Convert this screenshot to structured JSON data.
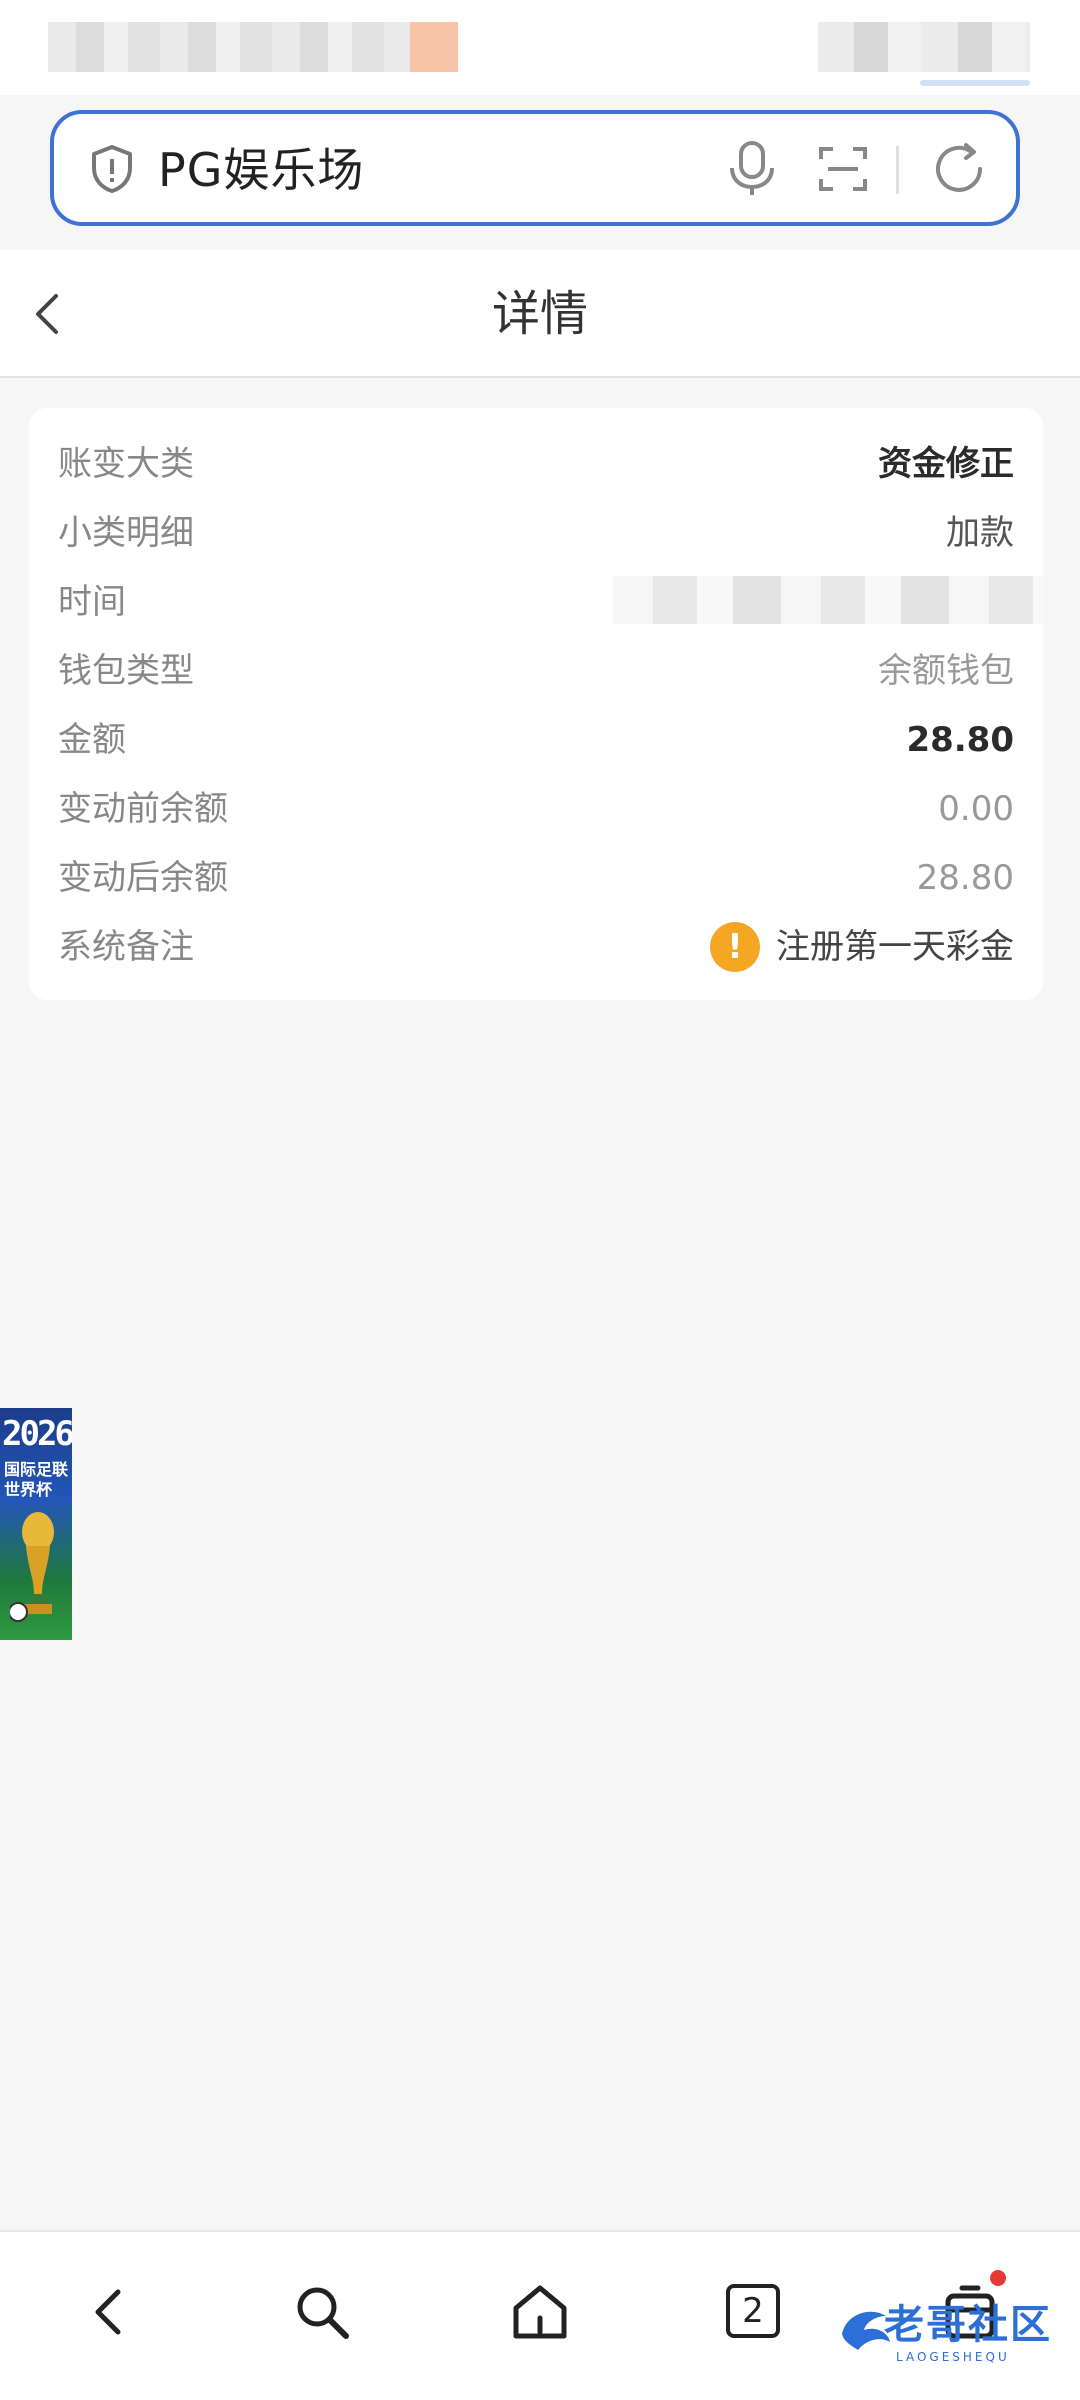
{
  "browser": {
    "url_text": "PG娱乐场"
  },
  "header": {
    "title": "详情"
  },
  "detail": {
    "rows": [
      {
        "label": "账变大类",
        "value": "资金修正"
      },
      {
        "label": "小类明细",
        "value": "加款"
      },
      {
        "label": "时间",
        "value": ""
      },
      {
        "label": "钱包类型",
        "value": "余额钱包"
      },
      {
        "label": "金额",
        "value": "28.80"
      },
      {
        "label": "变动前余额",
        "value": "0.00"
      },
      {
        "label": "变动后余额",
        "value": "28.80"
      },
      {
        "label": "系统备注",
        "value": "注册第一天彩金"
      }
    ]
  },
  "banner": {
    "year": "2026",
    "subtitle": "国际足联世界杯"
  },
  "bottom_nav": {
    "tab_count": "2"
  },
  "watermark": {
    "text": "老哥社区",
    "sub": "LAOGESHEQU"
  },
  "colors": {
    "accent": "#3f72d4",
    "warning": "#f5a623",
    "badge": "#e53935"
  }
}
